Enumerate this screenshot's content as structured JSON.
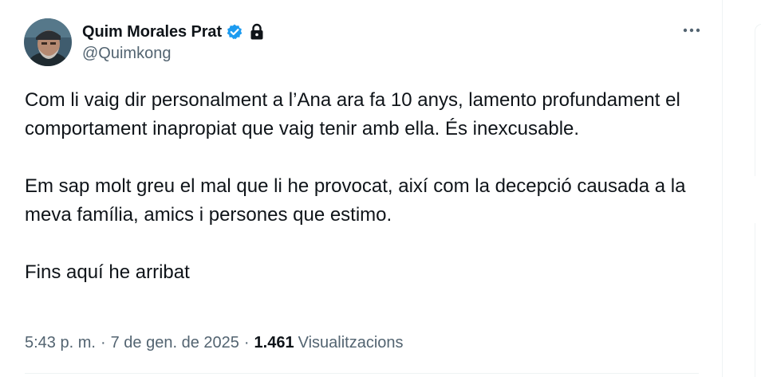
{
  "author": {
    "display_name": "Quim Morales Prat",
    "handle": "@Quimkong",
    "verified": true,
    "protected": true,
    "avatar_icon": "user-avatar-photo"
  },
  "tweet": {
    "paragraphs": [
      "Com li vaig dir personalment a l’Ana ara fa 10 anys, lamento profundament el comportament inapropiat que vaig tenir amb ella. És inexcusable.",
      "Em sap molt greu el mal que li he provocat, així com la decepció causada a la meva família, amics i persones que estimo.",
      "Fins aquí he arribat"
    ]
  },
  "meta": {
    "time": "5:43 p. m.",
    "separator": "·",
    "date": "7 de gen. de 2025",
    "views_count": "1.461",
    "views_label": "Visualitzacions"
  },
  "colors": {
    "text_primary": "#0f1419",
    "text_secondary": "#536471",
    "verified_blue": "#1d9bf0",
    "border": "#eff3f4"
  }
}
